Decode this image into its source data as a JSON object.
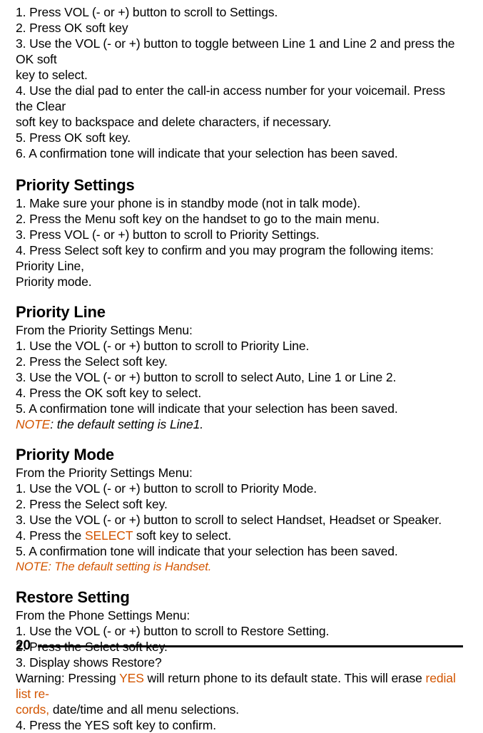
{
  "intro": {
    "s1": "1. Press VOL (- or +) button to scroll to Settings.",
    "s2": "2. Press OK soft key",
    "s3a": "3. Use the VOL (- or +) button to toggle between Line 1 and Line 2 and press the OK soft",
    "s3b": "key to select.",
    "s4a": "4. Use the dial pad to enter the call-in access number for your voicemail. Press the Clear",
    "s4b": "soft key to backspace and delete characters, if necessary.",
    "s5": "5. Press OK soft key.",
    "s6": "6. A confirmation tone will indicate that your selection has been saved."
  },
  "priority_settings": {
    "heading": "Priority Settings",
    "s1": "1. Make sure your phone is in standby mode (not in talk mode).",
    "s2": "2. Press the Menu soft key on the handset to go to the main menu.",
    "s3": "3. Press VOL (- or +) button to scroll to Priority Settings.",
    "s4a": "4. Press Select soft key to confirm and you may program the following items: Priority Line,",
    "s4b": "Priority mode."
  },
  "priority_line": {
    "heading": "Priority Line",
    "sub": "From the Priority Settings Menu:",
    "s1": "1. Use the VOL (- or +) button to scroll to Priority Line.",
    "s2": "2. Press the Select soft key.",
    "s3": "3. Use the VOL (- or +) button to scroll to select Auto, Line 1 or Line 2.",
    "s4": "4. Press the OK soft key to select.",
    "s5": "5. A confirmation tone will indicate that your selection has been saved.",
    "note_a": "NOTE",
    "note_b": ": the default setting is Line1."
  },
  "priority_mode": {
    "heading": "Priority Mode",
    "sub": "From the Priority Settings Menu:",
    "s1": "1. Use the VOL (- or +) button to scroll to Priority Mode.",
    "s2": "2. Press the Select soft key.",
    "s3": "3. Use the VOL (- or +) button to scroll to select Handset, Headset or Speaker.",
    "s4a": "4. Press the ",
    "s4b": "SELECT",
    "s4c": " soft key to select.",
    "s5": "5. A confirmation tone will indicate that your selection has been saved.",
    "note": "NOTE: The default setting is Handset."
  },
  "restore": {
    "heading": "Restore Setting",
    "sub": "From the Phone Settings Menu:",
    "s1": "1. Use the VOL (- or +) button to scroll to Restore Setting.",
    "s2": "2. Press the Select soft key.",
    "s3": "3. Display shows Restore?",
    "warn_a": "Warning: Pressing ",
    "warn_b": "YES",
    "warn_c": " will return phone to its default state. This will erase ",
    "warn_d": "redial list re-",
    "warn_e": "cords,",
    "warn_f": " date/time and all menu selections.",
    "s4": "4. Press the YES soft key to confirm."
  },
  "page_number": "20"
}
